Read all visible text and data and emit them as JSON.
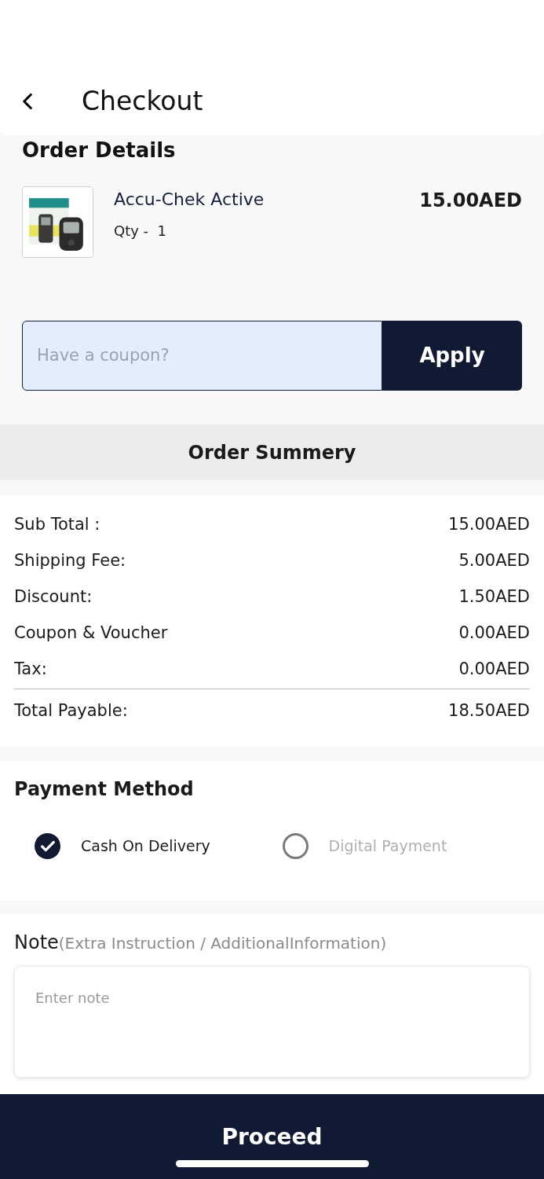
{
  "header": {
    "title": "Checkout"
  },
  "order_details": {
    "heading": "Order Details",
    "items": [
      {
        "kind": "picture",
        "name": "Accu-Chek Active",
        "qty": "Qty -  1",
        "price": "15.00AED"
      }
    ]
  },
  "coupon": {
    "placeholder": "Have a coupon?",
    "button": "Apply"
  },
  "summary": {
    "heading": "Order Summery",
    "rows": [
      {
        "label": "Sub Total :",
        "value": "15.00AED"
      },
      {
        "label": "Shipping Fee:",
        "value": "5.00AED"
      },
      {
        "label": "Discount:",
        "value": "1.50AED"
      },
      {
        "label": "Coupon & Voucher",
        "value": "0.00AED"
      },
      {
        "label": "Tax:",
        "value": "0.00AED"
      }
    ],
    "total": {
      "label": "Total Payable:",
      "value": "18.50AED"
    }
  },
  "payment": {
    "heading": "Payment Method",
    "options": [
      {
        "label": "Cash On Delivery",
        "selected": true
      },
      {
        "label": "Digital Payment",
        "selected": false
      }
    ]
  },
  "note": {
    "label": "Note",
    "hint": "(Extra Instruction / AdditionalInformation)",
    "placeholder": "Enter note"
  },
  "proceed": {
    "label": "Proceed"
  }
}
